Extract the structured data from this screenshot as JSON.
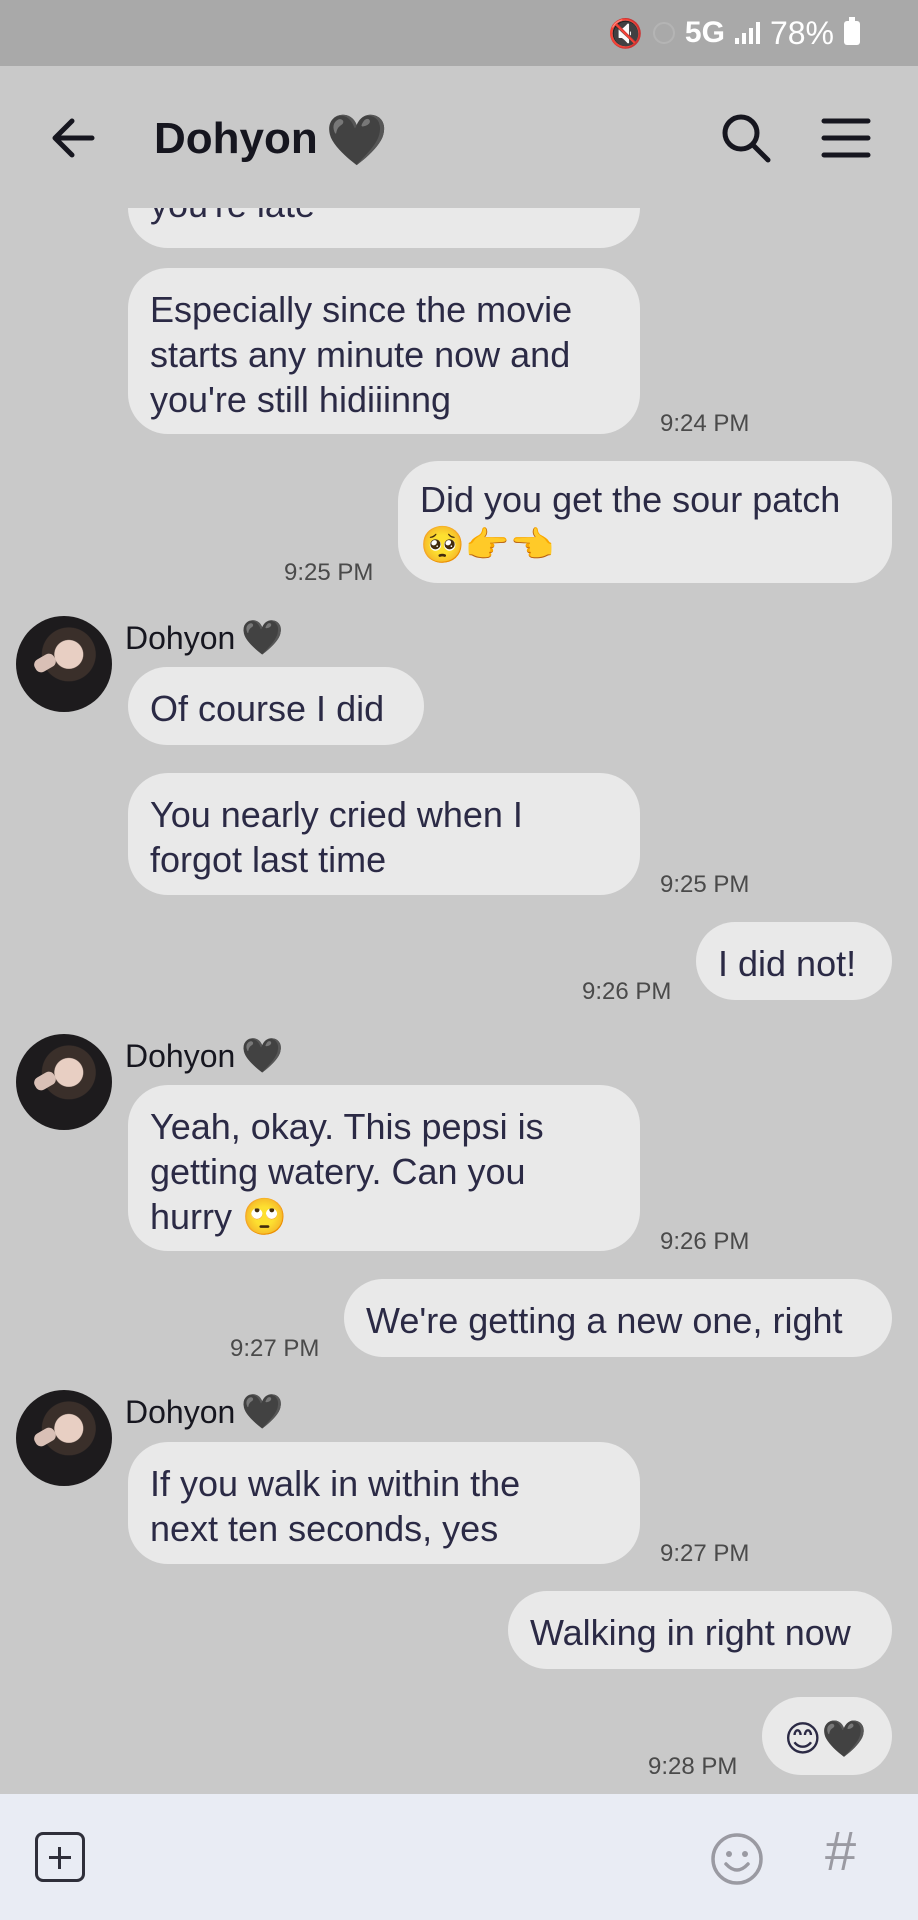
{
  "status_bar": {
    "network": "5G",
    "battery": "78%"
  },
  "header": {
    "title": "Dohyon",
    "title_emoji": "🖤"
  },
  "messages": [
    {
      "side": "left",
      "text": "you're late"
    },
    {
      "side": "left",
      "text": "Especially since the movie\nstarts any minute now and\nyou're still hidiiinng",
      "time": "9:24 PM"
    },
    {
      "side": "right",
      "text": "Did you get the sour patch\n🥺👉👈",
      "time": "9:25 PM"
    },
    {
      "side": "left",
      "sender": "Dohyon",
      "sender_emoji": "🖤",
      "text": "Of course I did"
    },
    {
      "side": "left",
      "text": "You nearly cried when I\nforgot last time",
      "time": "9:25 PM"
    },
    {
      "side": "right",
      "text": "I did not!",
      "time": "9:26 PM"
    },
    {
      "side": "left",
      "sender": "Dohyon",
      "sender_emoji": "🖤",
      "text": "Yeah, okay. This pepsi is\ngetting watery. Can you\nhurry 🙄",
      "time": "9:26 PM"
    },
    {
      "side": "right",
      "text": "We're getting a new one, right",
      "time": "9:27 PM"
    },
    {
      "side": "left",
      "sender": "Dohyon",
      "sender_emoji": "🖤",
      "text": "If you walk in within the\nnext ten seconds, yes",
      "time": "9:27 PM"
    },
    {
      "side": "right",
      "text": "Walking in right now"
    },
    {
      "side": "right",
      "text": "😊🖤",
      "time": "9:28 PM"
    }
  ],
  "bottom_bar": {
    "hash": "#"
  },
  "colors": {
    "background": "#c9c9c9",
    "bubble": "#e9e9e9",
    "text": "#2b2a45",
    "bottom_bar": "#e9ecf4"
  },
  "icons": [
    "back-arrow-icon",
    "search-icon",
    "menu-icon",
    "add-icon",
    "emoji-icon",
    "hashtag-icon"
  ]
}
